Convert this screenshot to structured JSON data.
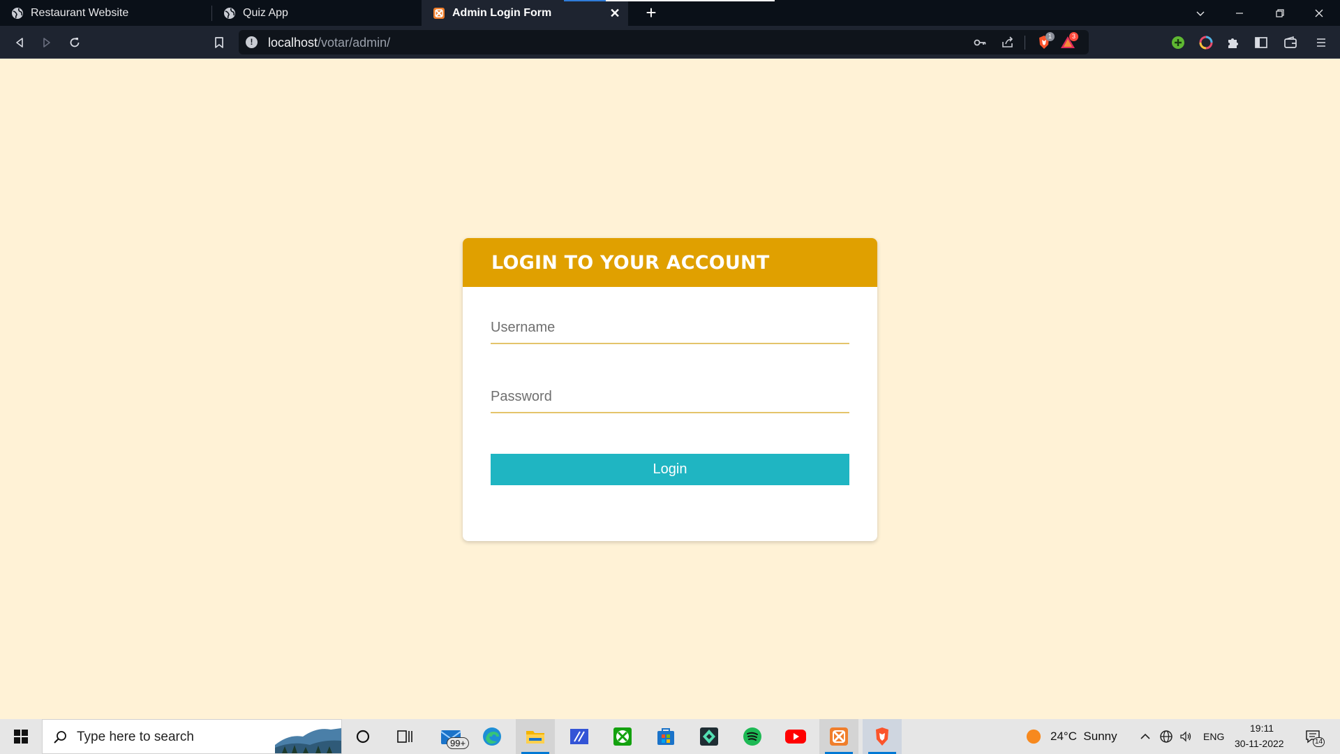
{
  "browser": {
    "tabs": [
      {
        "title": "Restaurant Website",
        "icon": "globe-icon",
        "active": false
      },
      {
        "title": "Quiz App",
        "icon": "globe-icon",
        "active": false
      },
      {
        "title": "Admin Login Form",
        "icon": "xampp-icon",
        "active": true
      }
    ],
    "url_host": "localhost",
    "url_path": "/votar/admin/",
    "brave_shield_count": "1",
    "rewards_badge": "3"
  },
  "login": {
    "title": "LOGIN TO YOUR ACCOUNT",
    "username_placeholder": "Username",
    "password_placeholder": "Password",
    "button_label": "Login"
  },
  "colors": {
    "page_bg": "#fff2d6",
    "header_bg": "#e0a000",
    "button_bg": "#1fb5c2",
    "field_underline": "#e4c46a"
  },
  "taskbar": {
    "search_placeholder": "Type here to search",
    "mail_badge": "99+",
    "weather": "24°C  Sunny",
    "language": "ENG",
    "time": "19:11",
    "date": "30-11-2022",
    "notifications": "14",
    "apps": [
      "cortana-icon",
      "task-view-icon",
      "mail-icon",
      "edge-icon",
      "file-explorer-icon",
      "pen-app-icon",
      "xbox-icon",
      "store-icon",
      "filmora-icon",
      "spotify-icon",
      "youtube-icon",
      "xampp-icon",
      "brave-icon"
    ]
  }
}
